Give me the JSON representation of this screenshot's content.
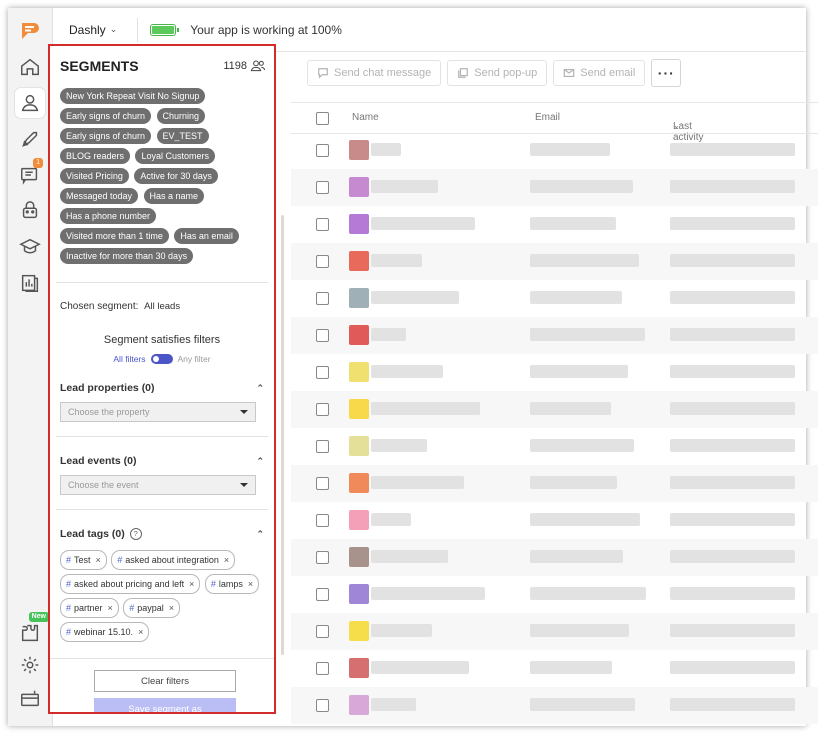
{
  "topbar": {
    "app_name": "Dashly",
    "status": "Your app is working at 100%",
    "battery_level": 1.0
  },
  "nav": {
    "items": [
      {
        "name": "logo"
      },
      {
        "name": "home-icon"
      },
      {
        "name": "leads-icon",
        "active": true
      },
      {
        "name": "rocket-icon"
      },
      {
        "name": "chats-icon",
        "badge": "1"
      },
      {
        "name": "bot-icon"
      },
      {
        "name": "academy-icon"
      },
      {
        "name": "reports-icon"
      }
    ],
    "bottom": [
      {
        "name": "integrations-icon",
        "badge": "New"
      },
      {
        "name": "settings-icon"
      },
      {
        "name": "billing-icon"
      }
    ]
  },
  "segments": {
    "title": "SEGMENTS",
    "count": "1198",
    "chips": [
      "New York Repeat Visit No Signup",
      "Early signs of churn",
      "Churning",
      "Early signs of churn",
      "EV_TEST",
      "BLOG readers",
      "Loyal Customers",
      "Visited Pricing",
      "Active for 30 days",
      "Messaged today",
      "Has a name",
      "Has a phone number",
      "Visited more than 1 time",
      "Has an email",
      "Inactive for more than 30 days"
    ],
    "chosen_label": "Chosen segment:",
    "chosen_value": "All leads",
    "satisfies": "Segment satisfies filters",
    "all_filters": "All filters",
    "any_filter": "Any filter",
    "props_title": "Lead properties (0)",
    "props_placeholder": "Choose the property",
    "events_title": "Lead events (0)",
    "events_placeholder": "Choose the event",
    "tags_title": "Lead tags (0)",
    "tags": [
      "Test",
      "asked about integration",
      "asked about pricing and left",
      "lamps",
      "partner",
      "paypal",
      "webinar 15.10."
    ],
    "clear": "Clear filters",
    "save": "Save segment as"
  },
  "toolbar": {
    "chat": "Send chat message",
    "popup": "Send pop-up",
    "email": "Send email",
    "more": "···"
  },
  "table": {
    "col_name": "Name",
    "col_email": "Email",
    "col_activity": "Last activity"
  },
  "colors": {
    "accent": "#4a55c8",
    "highlight_border": "#d32b2b",
    "save_button": "#bbbdf5",
    "logo": "#f08c3a"
  }
}
